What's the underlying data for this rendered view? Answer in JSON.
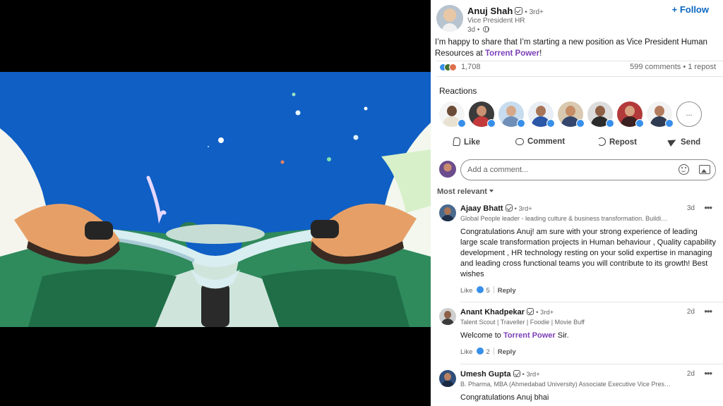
{
  "colors": {
    "link_blue": "#0a66c2",
    "mention_purple": "#7b3fb8",
    "sky_blue": "#0f5fc4",
    "handlebar_green": "#2e7d5a"
  },
  "post": {
    "author": {
      "name": "Anuj Shah",
      "degree": "3rd+",
      "title": "Vice President HR",
      "time": "3d"
    },
    "follow_label": "Follow",
    "text_before": "I’m happy to share that I’m starting a new position as Vice President Human Resources at ",
    "mention": "Torrent Power",
    "text_after": "!",
    "reaction_count": "1,708",
    "comments_reposts": "599 comments • 1 repost"
  },
  "reactions": {
    "title": "Reactions",
    "more_label": "..."
  },
  "actions": {
    "like": "Like",
    "comment": "Comment",
    "repost": "Repost",
    "send": "Send"
  },
  "comment_box": {
    "placeholder": "Add a comment..."
  },
  "sort_label": "Most relevant",
  "comments": [
    {
      "name": "Ajaay Bhatt",
      "degree": "• 3rd+",
      "headline": "Global People leader - leading culture & business transformation. Buildi…",
      "time": "3d",
      "menu": "•••",
      "text": "Congratulations Anuj! am sure with your strong experience of leading large scale transformation projects in Human behaviour , Quality capability development , HR technology resting on your solid expertise in managing and leading cross functional teams you will contribute to its growth! Best wishes",
      "like_label": "Like",
      "likes": "5",
      "reply_label": "Reply"
    },
    {
      "name": "Anant Khadpekar",
      "degree": "• 3rd+",
      "headline": "Talent Scout | Traveller | Foodie | Movie Buff",
      "time": "2d",
      "menu": "•••",
      "text_before": "Welcome to ",
      "mention": "Torrent Power",
      "text_after": " Sir.",
      "like_label": "Like",
      "likes": "2",
      "reply_label": "Reply"
    },
    {
      "name": "Umesh Gupta",
      "degree": "• 3rd+",
      "headline": "B. Pharma, MBA (Ahmedabad University) Associate Executive Vice Pres…",
      "time": "2d",
      "menu": "•••",
      "text": "Congratulations Anuj bhai"
    }
  ]
}
